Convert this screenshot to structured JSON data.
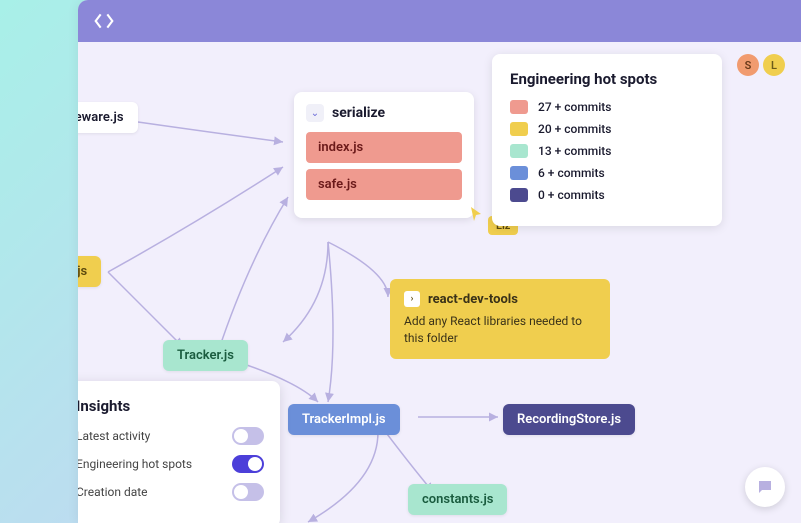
{
  "collaborators": [
    {
      "initial": "S",
      "class": "av-s"
    },
    {
      "initial": "L",
      "class": "av-l"
    }
  ],
  "nodes": {
    "middleware": "middleware.js",
    "index_root": "index.js",
    "tracker": "Tracker.js",
    "tracker_impl": "TrackerImpl.js",
    "recording_store": "RecordingStore.js",
    "constants": "constants.js"
  },
  "serialize": {
    "title": "serialize",
    "items": [
      "index.js",
      "safe.js"
    ]
  },
  "cursor_user": "Liz",
  "legend": {
    "title": "Engineering hot spots",
    "rows": [
      {
        "color": "#ef9a8f",
        "label": "27 + commits"
      },
      {
        "color": "#f0ce4e",
        "label": "20 + commits"
      },
      {
        "color": "#a8e6cf",
        "label": "13 + commits"
      },
      {
        "color": "#6b8fd9",
        "label": "6 + commits"
      },
      {
        "color": "#4c4a8f",
        "label": "0 + commits"
      }
    ]
  },
  "insights": {
    "title": "Insights",
    "rows": [
      {
        "label": "Latest activity",
        "on": false
      },
      {
        "label": "Engineering hot spots",
        "on": true
      },
      {
        "label": "Creation date",
        "on": false
      }
    ]
  },
  "note": {
    "title": "react-dev-tools",
    "body": "Add any React libraries needed to this folder"
  }
}
